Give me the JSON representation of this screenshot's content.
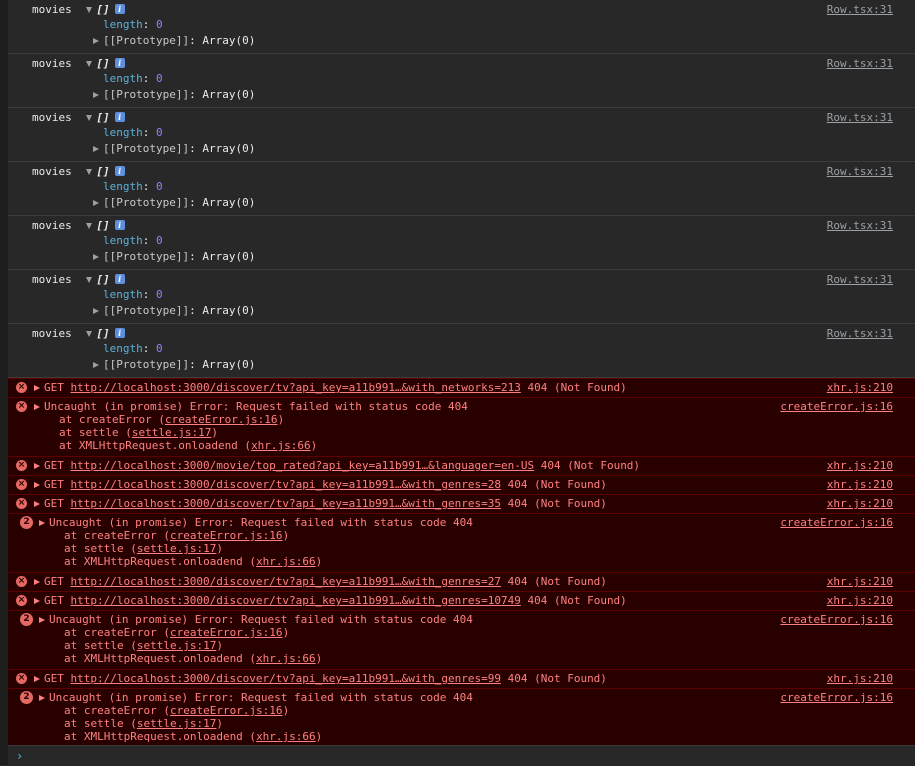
{
  "logs": [
    {
      "label": "movies",
      "array": "[]",
      "length_key": "length",
      "length_val": "0",
      "proto_key": "[[Prototype]]",
      "proto_val": "Array(0)",
      "source": "Row.tsx:31"
    },
    {
      "label": "movies",
      "array": "[]",
      "length_key": "length",
      "length_val": "0",
      "proto_key": "[[Prototype]]",
      "proto_val": "Array(0)",
      "source": "Row.tsx:31"
    },
    {
      "label": "movies",
      "array": "[]",
      "length_key": "length",
      "length_val": "0",
      "proto_key": "[[Prototype]]",
      "proto_val": "Array(0)",
      "source": "Row.tsx:31"
    },
    {
      "label": "movies",
      "array": "[]",
      "length_key": "length",
      "length_val": "0",
      "proto_key": "[[Prototype]]",
      "proto_val": "Array(0)",
      "source": "Row.tsx:31"
    },
    {
      "label": "movies",
      "array": "[]",
      "length_key": "length",
      "length_val": "0",
      "proto_key": "[[Prototype]]",
      "proto_val": "Array(0)",
      "source": "Row.tsx:31"
    },
    {
      "label": "movies",
      "array": "[]",
      "length_key": "length",
      "length_val": "0",
      "proto_key": "[[Prototype]]",
      "proto_val": "Array(0)",
      "source": "Row.tsx:31"
    },
    {
      "label": "movies",
      "array": "[]",
      "length_key": "length",
      "length_val": "0",
      "proto_key": "[[Prototype]]",
      "proto_val": "Array(0)",
      "source": "Row.tsx:31"
    }
  ],
  "info_icon": "i",
  "get1": {
    "method": "GET",
    "url": "http://localhost:3000/discover/tv?api_key=a11b991…&with_networks=213",
    "status": "404 (Not Found)",
    "source": "xhr.js:210"
  },
  "err1": {
    "message": "Uncaught (in promise) Error: Request failed with status code 404",
    "source": "createError.js:16",
    "at1": "at createError (",
    "at1_link": "createError.js:16",
    "at2": "at settle (",
    "at2_link": "settle.js:17",
    "at3": "at XMLHttpRequest.onloadend (",
    "at3_link": "xhr.js:66",
    "close": ")"
  },
  "get2": {
    "method": "GET",
    "url": "http://localhost:3000/movie/top_rated?api_key=a11b991…&languager=en-US",
    "status": "404 (Not Found)",
    "source": "xhr.js:210"
  },
  "get3": {
    "method": "GET",
    "url": "http://localhost:3000/discover/tv?api_key=a11b991…&with_genres=28",
    "status": "404 (Not Found)",
    "source": "xhr.js:210"
  },
  "get4": {
    "method": "GET",
    "url": "http://localhost:3000/discover/tv?api_key=a11b991…&with_genres=35",
    "status": "404 (Not Found)",
    "source": "xhr.js:210"
  },
  "err2": {
    "count": "2",
    "message": "Uncaught (in promise) Error: Request failed with status code 404",
    "source": "createError.js:16",
    "at1": "at createError (",
    "at1_link": "createError.js:16",
    "at2": "at settle (",
    "at2_link": "settle.js:17",
    "at3": "at XMLHttpRequest.onloadend (",
    "at3_link": "xhr.js:66",
    "close": ")"
  },
  "get5": {
    "method": "GET",
    "url": "http://localhost:3000/discover/tv?api_key=a11b991…&with_genres=27",
    "status": "404 (Not Found)",
    "source": "xhr.js:210"
  },
  "get6": {
    "method": "GET",
    "url": "http://localhost:3000/discover/tv?api_key=a11b991…&with_genres=10749",
    "status": "404 (Not Found)",
    "source": "xhr.js:210"
  },
  "err3": {
    "count": "2",
    "message": "Uncaught (in promise) Error: Request failed with status code 404",
    "source": "createError.js:16",
    "at1": "at createError (",
    "at1_link": "createError.js:16",
    "at2": "at settle (",
    "at2_link": "settle.js:17",
    "at3": "at XMLHttpRequest.onloadend (",
    "at3_link": "xhr.js:66",
    "close": ")"
  },
  "get7": {
    "method": "GET",
    "url": "http://localhost:3000/discover/tv?api_key=a11b991…&with_genres=99",
    "status": "404 (Not Found)",
    "source": "xhr.js:210"
  },
  "err4": {
    "count": "2",
    "message": "Uncaught (in promise) Error: Request failed with status code 404",
    "source": "createError.js:16",
    "at1": "at createError (",
    "at1_link": "createError.js:16",
    "at2": "at settle (",
    "at2_link": "settle.js:17",
    "at3": "at XMLHttpRequest.onloadend (",
    "at3_link": "xhr.js:66",
    "close": ")"
  },
  "error_icon": "×",
  "prompt": "›"
}
